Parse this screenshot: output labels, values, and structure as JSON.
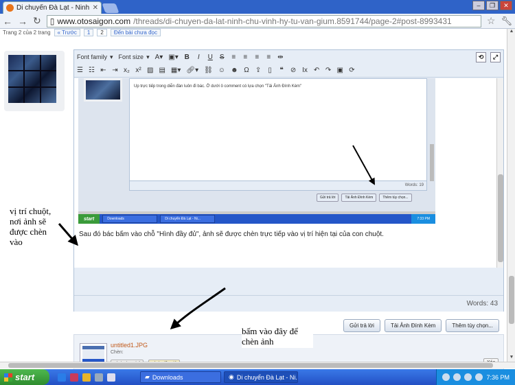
{
  "browser": {
    "tab_title": "Di chuyển Đà Lạt - Ninh Chữ",
    "url_domain": "www.otosaigon.com",
    "url_path": "/threads/di-chuyen-da-lat-ninh-chu-vinh-hy-tu-van-gium.8591744/page-2#post-8993431"
  },
  "pagenav": {
    "label": "Trang 2 của 2 trang",
    "prev": "« Trước",
    "p1": "1",
    "p2": "2",
    "unread": "Đến bài chưa đọc"
  },
  "toolbar": {
    "font_family": "Font family",
    "font_size": "Font size"
  },
  "embed": {
    "text": "Up trực tiếp trong diễn đàn luôn đi bác. Ở dưới ô comment có lựa chọn \"Tải Ảnh Đính Kèm\"",
    "words": "Words: 19",
    "btn_reply": "Gửi trả lời",
    "btn_attach": "Tải Ảnh Đính Kèm",
    "btn_more": "Thêm tùy chọn...",
    "start": "start",
    "task1": "Downloads",
    "task2": "Di chuyển Đà Lạt - Ni...",
    "clock": "7:33 PM"
  },
  "editor": {
    "body_text": "Sau đó bác bấm vào chỗ \"Hình đầy đủ\", ảnh sẽ được chèn trực tiếp vào vị trí hiện tại của con chuột.",
    "words": "Words: 43"
  },
  "actions": {
    "reply": "Gửi trả lời",
    "attach": "Tải Ảnh Đính Kèm",
    "more": "Thêm tùy chọn..."
  },
  "attachment": {
    "filename": "untitled1.JPG",
    "insert_label": "Chèn:",
    "thumb_btn": "Hình thu nhỏ",
    "full_btn": "Hình đầy đủ",
    "delete_btn": "Xóa"
  },
  "annotations": {
    "left": "vị trí chuột, nơi ảnh sẽ được chèn vào",
    "bottom": "bấm vào đây để chèn ảnh"
  },
  "taskbar": {
    "start": "start",
    "task1": "Downloads",
    "task2": "Di chuyển Đà Lạt - Ni...",
    "clock": "7:36 PM"
  }
}
